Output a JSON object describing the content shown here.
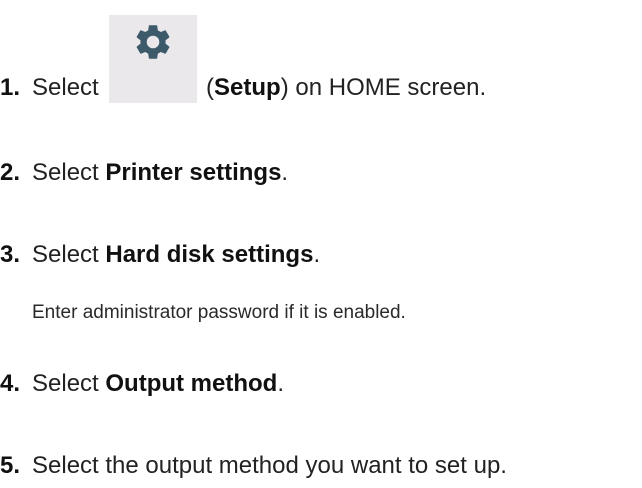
{
  "steps": [
    {
      "number": "1.",
      "before": "Select",
      "icon": "gear-icon",
      "paren_open": "(",
      "bold": "Setup",
      "paren_close": ")",
      "after": " on HOME screen."
    },
    {
      "number": "2.",
      "before": "Select ",
      "bold": "Printer settings",
      "after": "."
    },
    {
      "number": "3.",
      "before": "Select ",
      "bold": "Hard disk settings",
      "after": ".",
      "note": "Enter administrator password if it is enabled."
    },
    {
      "number": "4.",
      "before": "Select ",
      "bold": "Output method",
      "after": "."
    },
    {
      "number": "5.",
      "before": "Select the output method you want to set up.",
      "bold": "",
      "after": ""
    }
  ],
  "colors": {
    "icon_fill": "#3d5a6b",
    "icon_background": "#ebe8ec"
  }
}
